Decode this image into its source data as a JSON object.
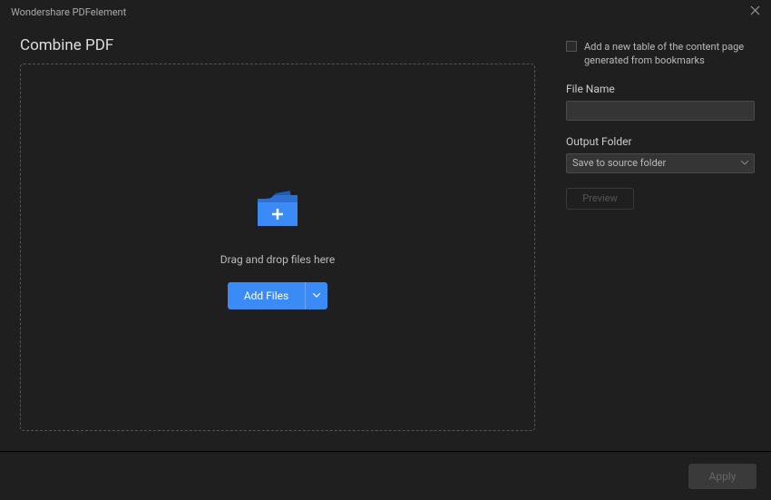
{
  "titlebar": {
    "app_name": "Wondershare PDFelement"
  },
  "main": {
    "title": "Combine PDF",
    "dropzone": {
      "hint": "Drag and drop files here",
      "add_button": "Add Files"
    }
  },
  "sidebar": {
    "checkbox_label": "Add a new table of the content page generated from bookmarks",
    "file_name": {
      "label": "File Name",
      "value": ""
    },
    "output_folder": {
      "label": "Output Folder",
      "selected": "Save to source folder"
    },
    "preview_button": "Preview"
  },
  "footer": {
    "apply_button": "Apply"
  }
}
